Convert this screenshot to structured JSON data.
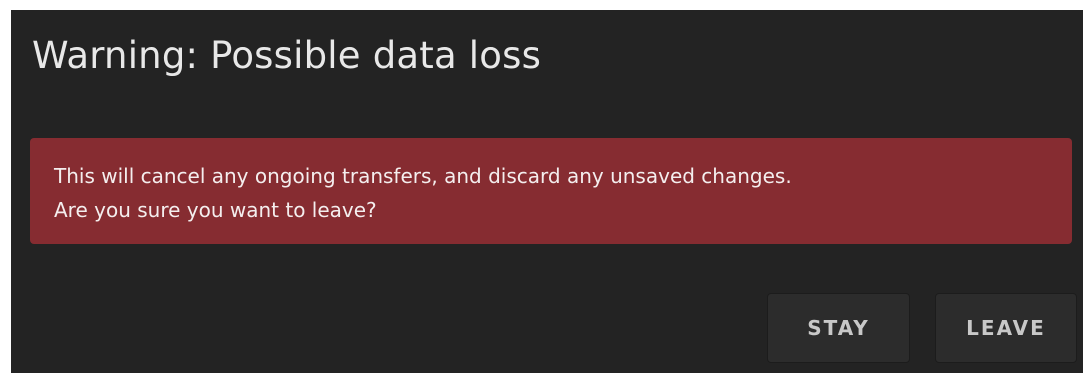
{
  "dialog": {
    "title": "Warning: Possible data loss",
    "alert": {
      "line1": "This will cancel any ongoing transfers, and discard any unsaved changes.",
      "line2": "Are you sure you want to leave?",
      "color": "#862c31"
    },
    "buttons": {
      "stay_label": "STAY",
      "leave_label": "LEAVE"
    },
    "background": "#232323"
  }
}
